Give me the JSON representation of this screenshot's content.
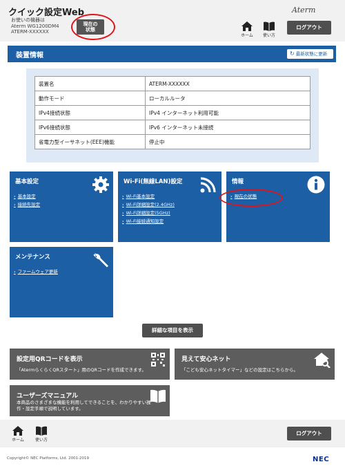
{
  "header": {
    "app_title": "クイック設定Web",
    "device_label": "お使いの機器は",
    "device_model": "Aterm WG1200DM4",
    "device_name": "ATERM-XXXXXX",
    "current_state_line1": "現在の",
    "current_state_line2": "状態",
    "brand_logo": "Aterm",
    "home_label": "ホーム",
    "manual_label": "使い方",
    "logout_label": "ログアウト"
  },
  "section": {
    "title": "装置情報",
    "refresh_label": "最新状態に更新"
  },
  "device_info": {
    "rows": [
      {
        "key": "装置名",
        "value": "ATERM-XXXXXX"
      },
      {
        "key": "動作モード",
        "value": "ローカルルータ"
      },
      {
        "key": "IPv4接続状態",
        "value": "IPv4 インターネット利用可能"
      },
      {
        "key": "IPv6接続状態",
        "value": "IPv6 インターネット未接続"
      },
      {
        "key": "省電力型イーサネット(EEE)機能",
        "value": "停止中"
      }
    ]
  },
  "tiles": {
    "basic": {
      "title": "基本設定",
      "icon": "gear-icon",
      "links": [
        "基本設定",
        "接続先設定"
      ]
    },
    "wifi": {
      "title": "Wi-Fi(無線LAN)設定",
      "icon": "wifi-icon",
      "links": [
        "Wi-Fi基本設定",
        "Wi-Fi詳細設定(2.4GHz)",
        "Wi-Fi詳細設定(5GHz)",
        "Wi-Fi接続通知設定"
      ]
    },
    "info": {
      "title": "情報",
      "icon": "info-icon",
      "links": [
        "現在の状態"
      ]
    },
    "maintenance": {
      "title": "メンテナンス",
      "icon": "wrench-icon",
      "links": [
        "ファームウェア更新"
      ]
    }
  },
  "detail_button_label": "詳細な項目を表示",
  "cards": {
    "qr": {
      "title": "設定用QRコードを表示",
      "desc": "「AtermらくらくQRスタート」用のQRコードを作成できます。",
      "icon": "qr-code-icon"
    },
    "safety": {
      "title": "見えて安心ネット",
      "desc": "「こども安心ネットタイマー」などの設定はこちらから。",
      "icon": "home-search-icon"
    },
    "manual": {
      "title": "ユーザーズマニュアル",
      "desc_line1": "本商品のさまざまな機能を利用してできることを、わかりやすい操",
      "desc_line2": "作・設定手順で説明しています。",
      "icon": "book-icon"
    }
  },
  "footer": {
    "home_label": "ホーム",
    "manual_label": "使い方",
    "logout_label": "ログアウト",
    "copyright": "Copyright© NEC Platforms, Ltd. 2001-2019",
    "nec_logo": "NEC"
  },
  "colors": {
    "primary_blue": "#1d5fa4",
    "panel_blue": "#dfe9f6",
    "dark_gray": "#4f4f4f",
    "card_gray": "#5d5d5d",
    "highlight_red": "#e0131b"
  }
}
